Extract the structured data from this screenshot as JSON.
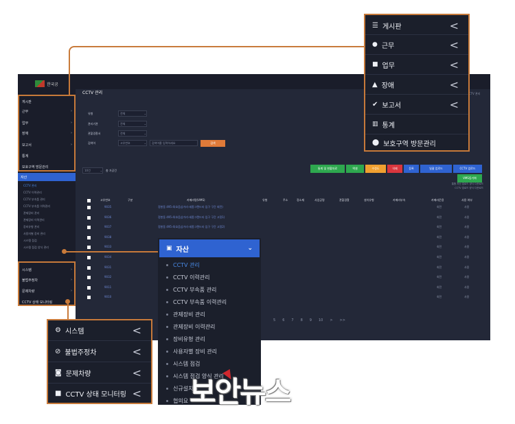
{
  "app": {
    "logo_text": "한국공",
    "page_title": "CCTV 관리",
    "breadcrumb": "CCTV 관리",
    "side_menu": [
      {
        "label": "게시판"
      },
      {
        "label": "근무"
      },
      {
        "label": "업무"
      },
      {
        "label": "장애"
      },
      {
        "label": "보고서"
      },
      {
        "label": "통계"
      },
      {
        "label": "보호구역 방문관리"
      }
    ],
    "side_section": "자산",
    "side_bottom": [
      {
        "label": "시스템"
      },
      {
        "label": "불법주정차"
      },
      {
        "label": "문제차량"
      },
      {
        "label": "CCTV 상태 모니터링"
      }
    ],
    "filters": [
      {
        "label": "유형",
        "value": "전체"
      },
      {
        "label": "관리기관",
        "value": "전체"
      },
      {
        "label": "관할경찰서",
        "value": "전체"
      },
      {
        "label": "검색어",
        "value": "고유번호",
        "placeholder": "검색어를 입력하세요"
      }
    ],
    "search_button": "검색",
    "page_size": "10건",
    "total": "총 가공건",
    "action_buttons": [
      {
        "label": "통계 및 현황자료",
        "color": "#2ea84f"
      },
      {
        "label": "엑셀",
        "color": "#2ea84f"
      },
      {
        "label": "수정도",
        "color": "#f0a030"
      },
      {
        "label": "삭제",
        "color": "#d9363e"
      },
      {
        "label": "등록",
        "color": "#2f63d1"
      },
      {
        "label": "일괄 업로드",
        "color": "#2f63d1"
      },
      {
        "label": "CCTV 업로드",
        "color": "#2f63d1"
      }
    ],
    "vms_button": "VMS동기화",
    "note_line1": "통합 자산 업로드 양식 다운로드",
    "note_line2": "CCTV 업로드 양식 다운로드",
    "table_headers": [
      "고유번호",
      "구분",
      "카메라명(VMS)",
      "유형",
      "주소",
      "정소재",
      "사업공명",
      "관할경찰",
      "설치유형",
      "카메라부속",
      "카메라운용",
      "사용 여부"
    ],
    "rows": [
      {
        "id": "9035",
        "name": "정봉동 495-4(호음삼거리-세종그랜드타 입구 구간 회전)",
        "op": "회전",
        "use": "사용"
      },
      {
        "id": "9036",
        "name": "정봉동 495-4(호음삼거리-세종그랜드타 입구 구간 고정1)",
        "op": "회전",
        "use": "사용"
      },
      {
        "id": "9037",
        "name": "정봉동 495-4(호음삼거리-세종그랜드타 입구 구간 고정2)",
        "op": "회전",
        "use": "사용"
      },
      {
        "id": "9038",
        "name": "",
        "op": "회전",
        "use": "사용"
      },
      {
        "id": "9033",
        "name": "",
        "op": "회전",
        "use": "사용"
      },
      {
        "id": "9034",
        "name": "",
        "op": "회전",
        "use": "사용"
      },
      {
        "id": "9031",
        "name": "",
        "op": "회전",
        "use": "사용"
      },
      {
        "id": "9032",
        "name": "",
        "op": "회전",
        "use": "사용"
      },
      {
        "id": "9011",
        "name": "",
        "op": "회전",
        "use": "사용"
      },
      {
        "id": "9010",
        "name": "",
        "op": "회전",
        "use": "사용"
      }
    ],
    "pager": [
      "5",
      "6",
      "7",
      "8",
      "9",
      "10",
      ">",
      ">>"
    ]
  },
  "top_callout": {
    "items": [
      {
        "label": "게시판",
        "icon": "list-icon",
        "chevron": "<"
      },
      {
        "label": "근무",
        "icon": "user-icon",
        "chevron": "<"
      },
      {
        "label": "업무",
        "icon": "briefcase-icon",
        "chevron": "<"
      },
      {
        "label": "장애",
        "icon": "warning-icon",
        "chevron": "<"
      },
      {
        "label": "보고서",
        "icon": "check-icon",
        "chevron": "<"
      },
      {
        "label": "통계",
        "icon": "bar-chart-icon"
      },
      {
        "label": "보호구역 방문관리",
        "icon": "map-pin-icon"
      }
    ]
  },
  "asset_callout": {
    "title": "자산",
    "items": [
      {
        "label": "CCTV 관리",
        "active": true
      },
      {
        "label": "CCTV 이력관리"
      },
      {
        "label": "CCTV 부속품 관리"
      },
      {
        "label": "CCTV 부속품 이력관리"
      },
      {
        "label": "관제장비 관리"
      },
      {
        "label": "관제장비 이력관리"
      },
      {
        "label": "장비유형 관리"
      },
      {
        "label": "사용자별 장비 관리"
      },
      {
        "label": "시스템 점검"
      },
      {
        "label": "시스템 점검 양식 관리"
      },
      {
        "label": "신규설치"
      },
      {
        "label": "협의요"
      }
    ]
  },
  "bottom_callout": {
    "items": [
      {
        "label": "시스템",
        "icon": "cogs-icon",
        "chevron": "<"
      },
      {
        "label": "불법주정차",
        "icon": "ban-icon",
        "chevron": "<"
      },
      {
        "label": "문제차량",
        "icon": "car-icon",
        "chevron": "<"
      },
      {
        "label": "CCTV 상태 모니터링",
        "icon": "video-icon",
        "chevron": "<"
      }
    ]
  },
  "watermark": "보안뉴스",
  "colors": {
    "accent": "#2f63d1",
    "callout_border": "#c87a3a",
    "panel_bg": "#1b1f2b"
  }
}
